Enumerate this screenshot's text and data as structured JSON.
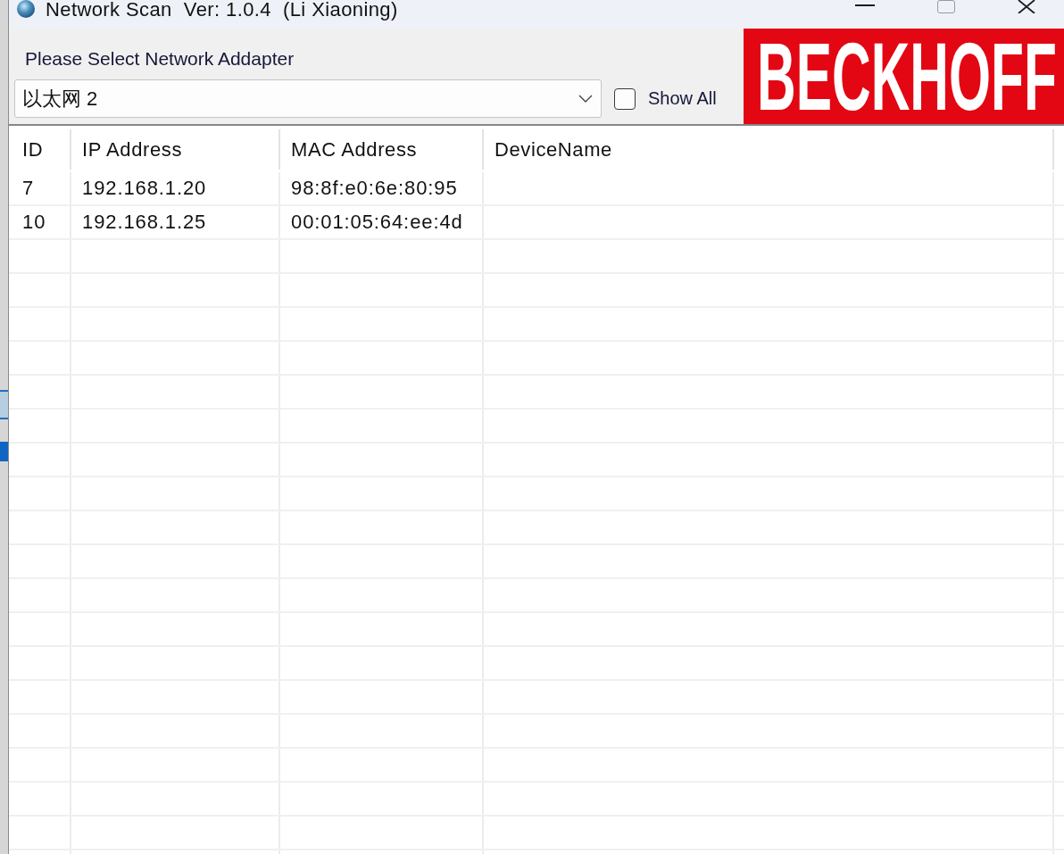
{
  "window": {
    "title": "Network Scan  Ver: 1.0.4  (Li Xiaoning)"
  },
  "adapter": {
    "label": "Please Select Network Addapter",
    "value": "以太网 2"
  },
  "show_all": {
    "label": "Show All",
    "checked": false
  },
  "logo": {
    "text": "BECKHOFF"
  },
  "table": {
    "columns": [
      "ID",
      "IP Address",
      "MAC Address",
      "DeviceName"
    ],
    "rows": [
      {
        "cells": [
          "7",
          "192.168.1.20",
          "98:8f:e0:6e:80:95"
        ]
      },
      {
        "cells": [
          "10",
          "192.168.1.25",
          "00:01:05:64:ee:4d"
        ]
      }
    ]
  }
}
